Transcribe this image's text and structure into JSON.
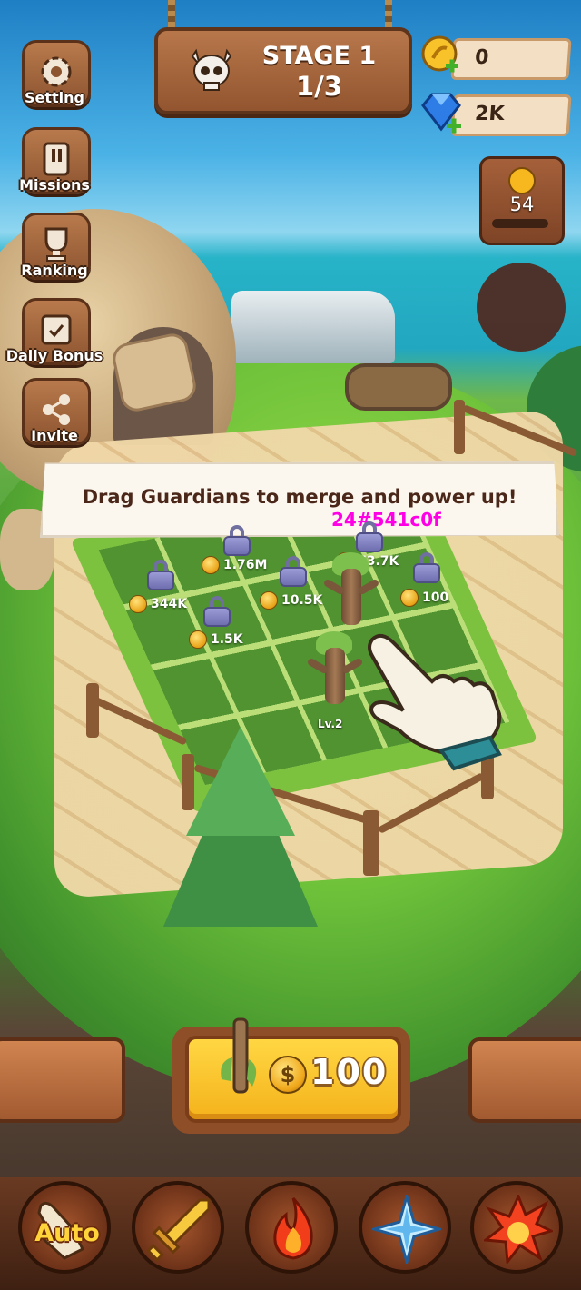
{
  "header": {
    "stage_title": "STAGE 1",
    "stage_progress": "1/3"
  },
  "resources": {
    "gold": "0",
    "gems": "2K"
  },
  "side_menu": [
    {
      "label": "Setting",
      "icon": "gear-icon"
    },
    {
      "label": "Missions",
      "icon": "scroll-icon"
    },
    {
      "label": "Ranking",
      "icon": "trophy-icon"
    },
    {
      "label": "Daily Bonus",
      "icon": "calendar-icon"
    },
    {
      "label": "Invite",
      "icon": "share-icon"
    }
  ],
  "coin_counter": {
    "value": "54"
  },
  "tutorial": {
    "message": "Drag Guardians to merge and power up!",
    "debug_overlay": "24#541c0f"
  },
  "board": {
    "slot_prices": [
      "1.76M",
      "73.7K",
      "344K",
      "10.5K",
      "100",
      "1.5K"
    ],
    "guardian_level": "Lv.2"
  },
  "buy_button": {
    "price": "100"
  },
  "skills": [
    {
      "name": "auto",
      "label": "Auto",
      "icon": "hand-icon"
    },
    {
      "name": "sword",
      "icon": "sword-icon"
    },
    {
      "name": "fire",
      "icon": "flame-icon"
    },
    {
      "name": "ice",
      "icon": "ice-star-icon"
    },
    {
      "name": "explosion",
      "icon": "explosion-icon"
    }
  ],
  "colors": {
    "debug_dot": "#541c0f",
    "debug_text": "#ff00e6",
    "wood": "#a5633a",
    "button_yellow": "#f8c12a"
  }
}
